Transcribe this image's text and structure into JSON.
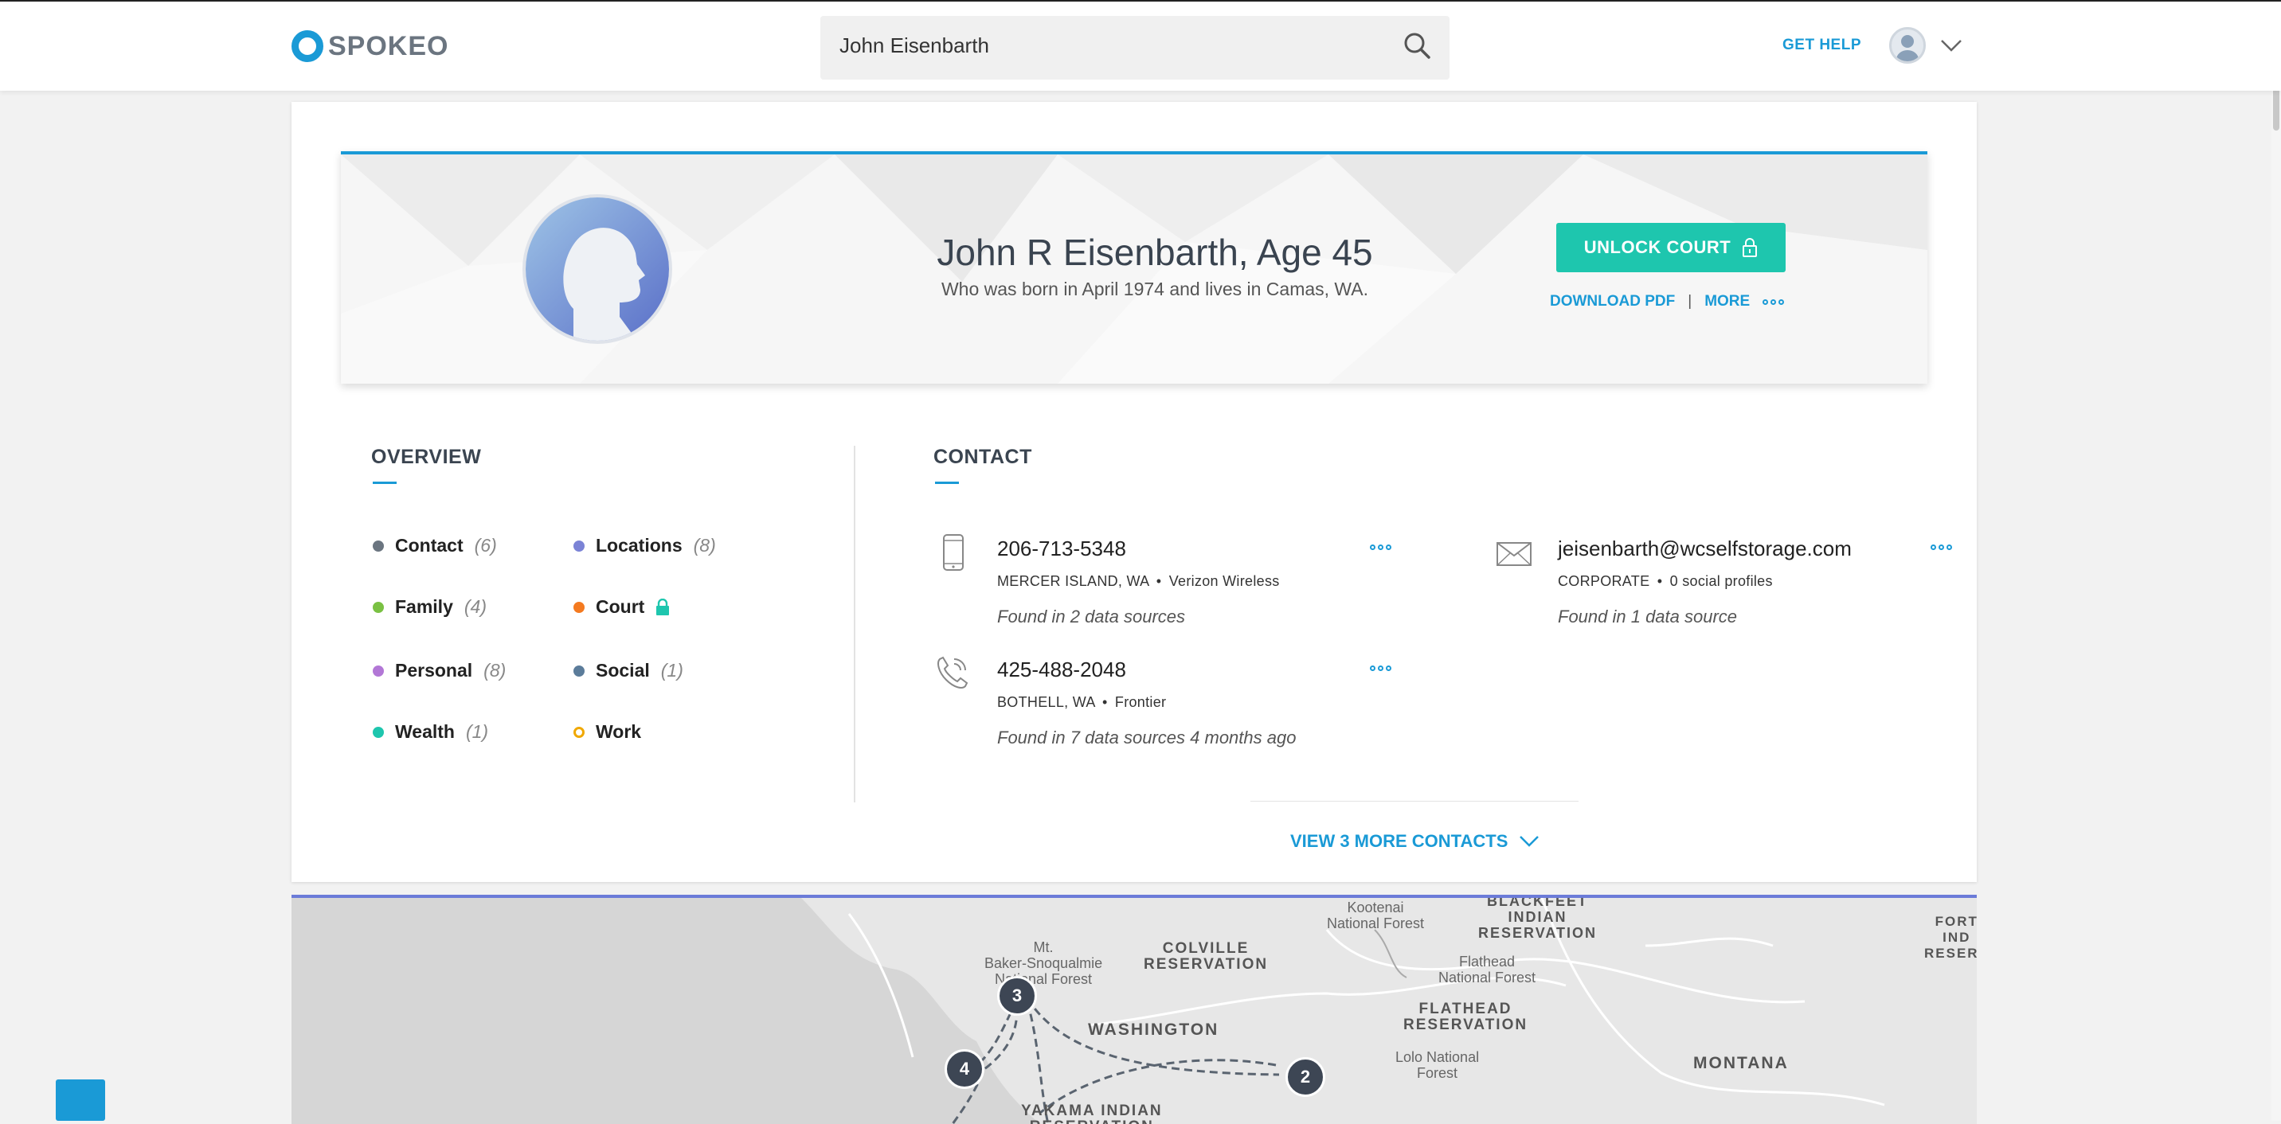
{
  "header": {
    "logo_text": "SPOKEO",
    "search_value": "John Eisenbarth",
    "get_help": "GET HELP"
  },
  "profile": {
    "name": "John R Eisenbarth, Age 45",
    "subtitle": "Who was born in April 1974 and lives in Camas, WA.",
    "unlock_label": "UNLOCK COURT",
    "download_pdf": "DOWNLOAD PDF",
    "separator": "|",
    "more": "MORE"
  },
  "overview": {
    "title": "OVERVIEW",
    "items": [
      {
        "label": "Contact",
        "count": "(6)",
        "color": "#6b7580"
      },
      {
        "label": "Locations",
        "count": "(8)",
        "color": "#7b83d6"
      },
      {
        "label": "Family",
        "count": "(4)",
        "color": "#7ac143"
      },
      {
        "label": "Court",
        "count": "",
        "color": "#f47a20"
      },
      {
        "label": "Personal",
        "count": "(8)",
        "color": "#b277d6"
      },
      {
        "label": "Social",
        "count": "(1)",
        "color": "#5b7c9a"
      },
      {
        "label": "Wealth",
        "count": "(1)",
        "color": "#1ec6ae"
      },
      {
        "label": "Work",
        "count": "",
        "color": "#f0a800"
      }
    ]
  },
  "contact": {
    "title": "CONTACT",
    "phones": [
      {
        "number": "206-713-5348",
        "location": "MERCER ISLAND, WA",
        "carrier": "Verizon Wireless",
        "found": "Found in 2 data sources"
      },
      {
        "number": "425-488-2048",
        "location": "BOTHELL, WA",
        "carrier": "Frontier",
        "found": "Found in 7 data sources 4 months ago"
      }
    ],
    "email": {
      "address": "jeisenbarth@wcselfstorage.com",
      "type": "CORPORATE",
      "social": "0 social profiles",
      "found": "Found in 1 data source"
    },
    "view_more": "VIEW 3 MORE CONTACTS"
  },
  "map": {
    "labels": {
      "kootenai": "Kootenai\nNational Forest",
      "blackfeet": "BLACKFEET\nINDIAN\nRESERVATION",
      "fort": "FORT\nIND\nRESERV",
      "mt_baker": "Mt.\nBaker-Snoqualmie\nNational Forest",
      "colville": "COLVILLE\nRESERVATION",
      "flathead_nf": "Flathead\nNational Forest",
      "flathead_res": "FLATHEAD\nRESERVATION",
      "washington": "WASHINGTON",
      "lolo": "Lolo National\nForest",
      "montana": "MONTANA",
      "yakama": "YAKAMA INDIAN\nRESERVATION"
    },
    "markers": [
      "3",
      "4",
      "2"
    ]
  },
  "colors": {
    "accent": "#1a9ad6",
    "teal": "#1ec6ae"
  }
}
